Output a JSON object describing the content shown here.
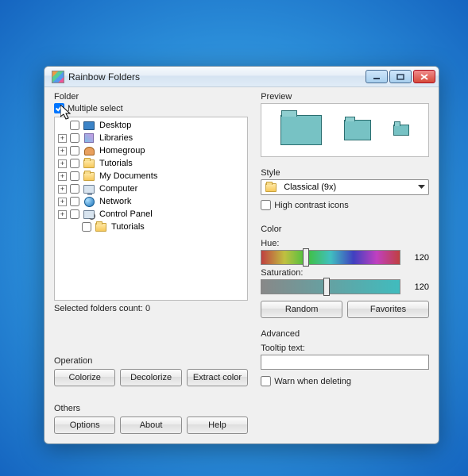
{
  "window": {
    "title": "Rainbow Folders"
  },
  "folder": {
    "legend": "Folder",
    "multiple_select_label": "Multiple select",
    "multiple_select_checked": true,
    "count_text": "Selected folders count: 0",
    "nodes": [
      {
        "label": "Desktop",
        "icon": "desktop-ico",
        "indent": false,
        "expander": "none"
      },
      {
        "label": "Libraries",
        "icon": "libraries-ico",
        "indent": false,
        "expander": "plus"
      },
      {
        "label": "Homegroup",
        "icon": "homegroup-ico",
        "indent": false,
        "expander": "plus"
      },
      {
        "label": "Tutorials",
        "icon": "folder-ico",
        "indent": false,
        "expander": "plus"
      },
      {
        "label": "My Documents",
        "icon": "folder-ico",
        "indent": false,
        "expander": "plus"
      },
      {
        "label": "Computer",
        "icon": "computer-ico",
        "indent": false,
        "expander": "plus"
      },
      {
        "label": "Network",
        "icon": "network-ico",
        "indent": false,
        "expander": "plus"
      },
      {
        "label": "Control Panel",
        "icon": "cpanel-ico",
        "indent": false,
        "expander": "plus"
      },
      {
        "label": "Tutorials",
        "icon": "folder-ico",
        "indent": true,
        "expander": "none"
      }
    ]
  },
  "operation": {
    "legend": "Operation",
    "colorize": "Colorize",
    "decolorize": "Decolorize",
    "extract": "Extract color"
  },
  "others": {
    "legend": "Others",
    "options": "Options",
    "about": "About",
    "help": "Help"
  },
  "preview": {
    "legend": "Preview"
  },
  "style": {
    "legend": "Style",
    "selected": "Classical (9x)",
    "high_contrast": "High contrast icons"
  },
  "color": {
    "legend": "Color",
    "hue_label": "Hue:",
    "hue_value": "120",
    "sat_label": "Saturation:",
    "sat_value": "120",
    "random": "Random",
    "favorites": "Favorites"
  },
  "advanced": {
    "legend": "Advanced",
    "tooltip_label": "Tooltip text:",
    "tooltip_value": "",
    "warn_label": "Warn when deleting"
  }
}
